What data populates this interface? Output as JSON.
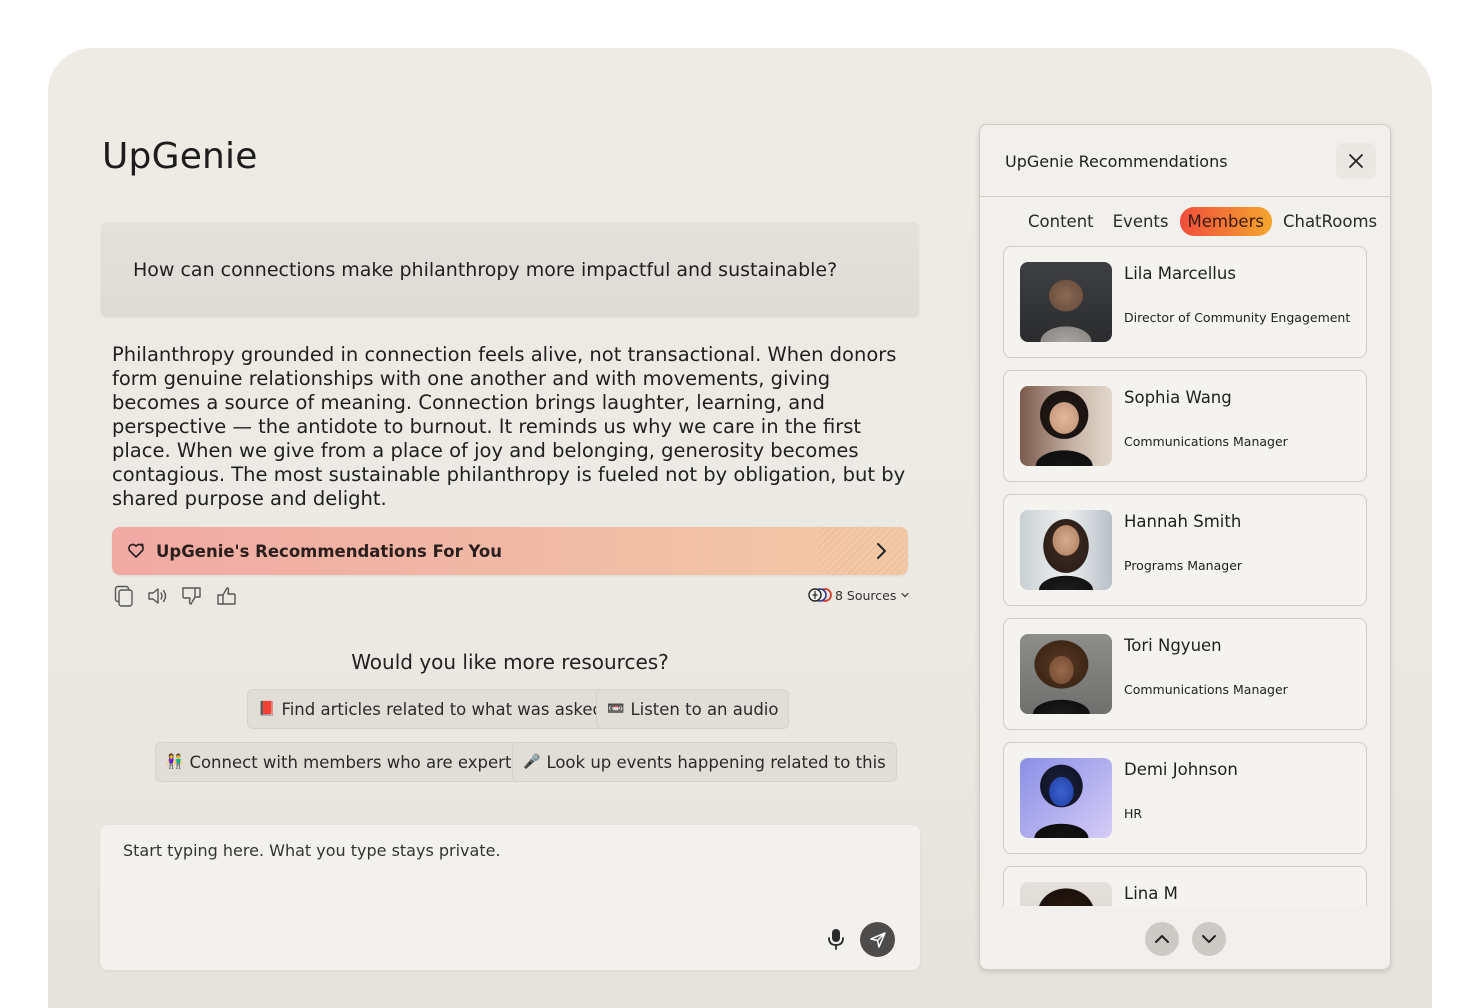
{
  "app": {
    "title": "UpGenie"
  },
  "chat": {
    "question": "How can connections make philanthropy more impactful and sustainable?",
    "answer": "Philanthropy grounded in connection feels alive, not transactional. When donors form genuine relationships with one another and with movements, giving becomes a source of meaning. Connection brings laughter, learning, and perspective — the antidote to burnout. It reminds us why we care in the first place. When we give from a place of joy and belonging, generosity becomes contagious. The most sustainable philanthropy is fueled not by obligation, but by shared purpose and delight.",
    "recommendations_banner": "UpGenie's Recommendations For You",
    "sources_label": "8 Sources",
    "more_resources_title": "Would you like more resources?",
    "suggestions": [
      {
        "emoji": "📕",
        "label": "Find articles related to what was asked"
      },
      {
        "emoji": "📼",
        "label": "Listen to an audio"
      },
      {
        "emoji": "👫",
        "label": "Connect with members who are experts"
      },
      {
        "emoji": "🎤",
        "label": "Look up events happening related to this"
      }
    ],
    "input_placeholder": "Start typing here. What you type stays private."
  },
  "panel": {
    "title": "UpGenie Recommendations",
    "tabs": [
      "Content",
      "Events",
      "Members",
      "ChatRooms"
    ],
    "active_tab": "Members",
    "members": [
      {
        "name": "Lila Marcellus",
        "role": "Director of Community Engagement"
      },
      {
        "name": "Sophia Wang",
        "role": "Communications Manager"
      },
      {
        "name": "Hannah Smith",
        "role": "Programs Manager"
      },
      {
        "name": "Tori Ngyuen",
        "role": "Communications Manager"
      },
      {
        "name": "Demi Johnson",
        "role": "HR"
      },
      {
        "name": "Lina M",
        "role": ""
      }
    ]
  },
  "colors": {
    "active_tab_start": "#f04e3a",
    "active_tab_end": "#f5a62f",
    "banner_start": "#f0a9a3",
    "banner_end": "#f2c9a6",
    "send_button": "#4e4c4a"
  },
  "icons": [
    "copy-icon",
    "speaker-icon",
    "thumbs-down-icon",
    "thumbs-up-icon",
    "sparkle-heart-icon",
    "chevron-right-icon",
    "close-icon",
    "microphone-icon",
    "send-icon",
    "chevron-up-icon",
    "chevron-down-icon"
  ]
}
